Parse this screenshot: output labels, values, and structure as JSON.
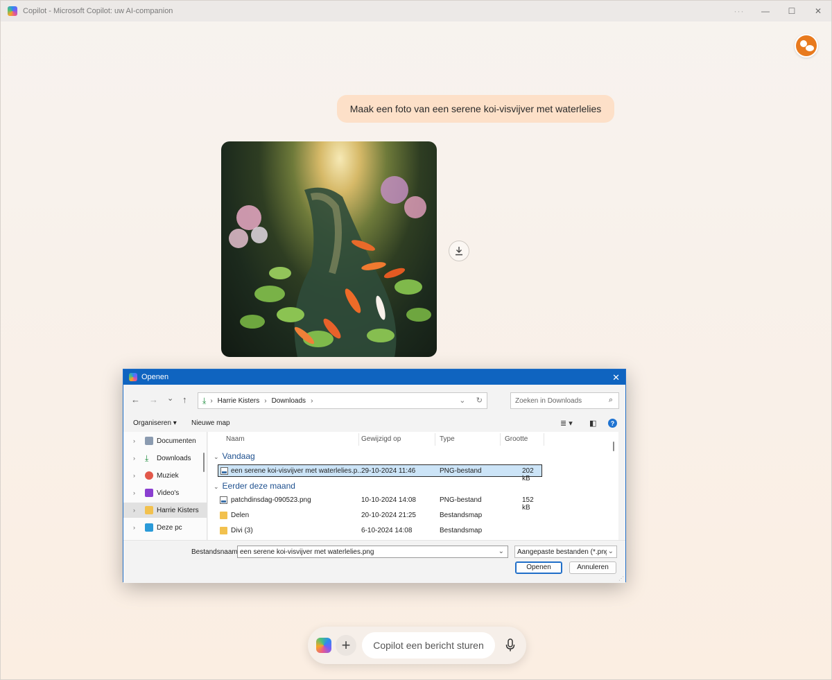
{
  "window": {
    "title": "Copilot - Microsoft Copilot: uw AI-companion",
    "controls": {
      "more": "···",
      "minimize": "—",
      "maximize": "☐",
      "close": "✕"
    }
  },
  "conversation": {
    "user_message": "Maak een foto van een serene koi-visvijver met waterlelies",
    "image_alt_description_visible": false,
    "download_icon": "download-icon"
  },
  "dialog": {
    "title": "Openen",
    "close": "✕",
    "nav": {
      "back": "←",
      "forward": "→",
      "recent": "⌄",
      "up": "↑"
    },
    "address": {
      "crumbs": [
        "Harrie Kisters",
        "Downloads"
      ],
      "sep": "›",
      "dropdown": "⌄",
      "refresh": "↻"
    },
    "search": {
      "placeholder": "Zoeken in Downloads",
      "icon": "⌕"
    },
    "toolbar": {
      "organize": "Organiseren ▾",
      "new_folder": "Nieuwe map",
      "view": "≣ ▾",
      "pane": "◧",
      "help": "?"
    },
    "navpane": [
      {
        "label": "Documenten",
        "icon": "documents-icon",
        "color": "#8b9bb0"
      },
      {
        "label": "Downloads",
        "icon": "downloads-icon",
        "color": "#1a8a3a"
      },
      {
        "label": "Muziek",
        "icon": "music-icon",
        "color": "#e2584a"
      },
      {
        "label": "Video's",
        "icon": "videos-icon",
        "color": "#8a3fd0"
      },
      {
        "label": "Harrie Kisters",
        "icon": "folder-icon",
        "color": "#f2c14e"
      },
      {
        "label": "Deze pc",
        "icon": "pc-icon",
        "color": "#2a9ad8"
      }
    ],
    "columns": {
      "name": "Naam",
      "modified": "Gewijzigd op",
      "type": "Type",
      "size": "Grootte"
    },
    "groups": {
      "today": "Vandaag",
      "earlier": "Eerder deze maand"
    },
    "files_today": [
      {
        "name": "een serene koi-visvijver met waterlelies.p...",
        "modified": "29-10-2024 11:46",
        "type": "PNG-bestand",
        "size": "202 kB",
        "kind": "png",
        "selected": true
      }
    ],
    "files_earlier": [
      {
        "name": "patchdinsdag-090523.png",
        "modified": "10-10-2024 14:08",
        "type": "PNG-bestand",
        "size": "152 kB",
        "kind": "png"
      },
      {
        "name": "Delen",
        "modified": "20-10-2024 21:25",
        "type": "Bestandsmap",
        "size": "",
        "kind": "folder"
      },
      {
        "name": "Divi (3)",
        "modified": "6-10-2024 14:08",
        "type": "Bestandsmap",
        "size": "",
        "kind": "folder"
      }
    ],
    "filename_label": "Bestandsnaam:",
    "filename_value": "een serene koi-visvijver met waterlelies.png",
    "filetype": "Aangepaste bestanden (*.png;*",
    "open_button": "Openen",
    "cancel_button": "Annuleren"
  },
  "composer": {
    "placeholder": "Copilot een bericht sturen",
    "plus": "+"
  }
}
